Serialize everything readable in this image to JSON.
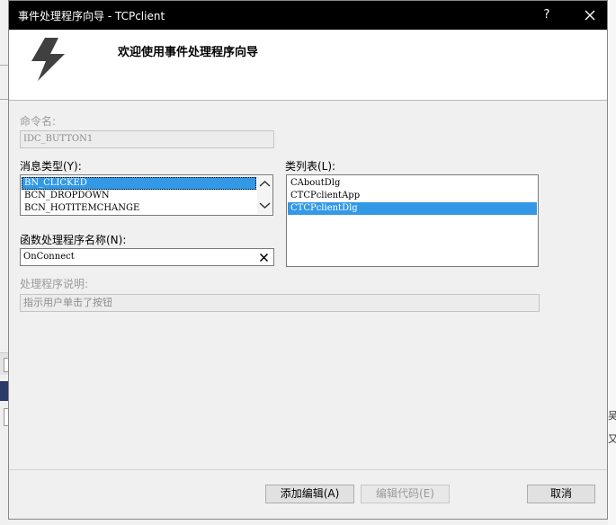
{
  "window": {
    "title": "事件处理程序向导 - TCPclient",
    "help_label": "?",
    "header_title": "欢迎使用事件处理程序向导"
  },
  "command_name": {
    "label": "命令名:",
    "value": "IDC_BUTTON1"
  },
  "message_type": {
    "label": "消息类型(Y):",
    "items": [
      "BN_CLICKED",
      "BCN_DROPDOWN",
      "BCN_HOTITEMCHANGE"
    ],
    "selected_index": 0
  },
  "class_list": {
    "label": "类列表(L):",
    "items": [
      "CAboutDlg",
      "CTCPclientApp",
      "CTCPclientDlg"
    ],
    "selected_index": 2
  },
  "handler_name": {
    "label": "函数处理程序名称(N):",
    "value": "OnConnect"
  },
  "handler_description": {
    "label": "处理程序说明:",
    "value": "指示用户单击了按钮"
  },
  "buttons": {
    "add_edit": "添加编辑(A)",
    "edit_code": "编辑代码(E)",
    "cancel": "取消"
  },
  "background_fragments": {
    "glyph1": "吴",
    "glyph2": "又"
  },
  "colors": {
    "selection": "#3399e6",
    "titlebar": "#000000",
    "accent_icon": "#404040"
  },
  "icons": [
    "lightning-bolt-icon",
    "close-icon",
    "clear-icon",
    "scroll-up-icon",
    "scroll-down-icon"
  ]
}
